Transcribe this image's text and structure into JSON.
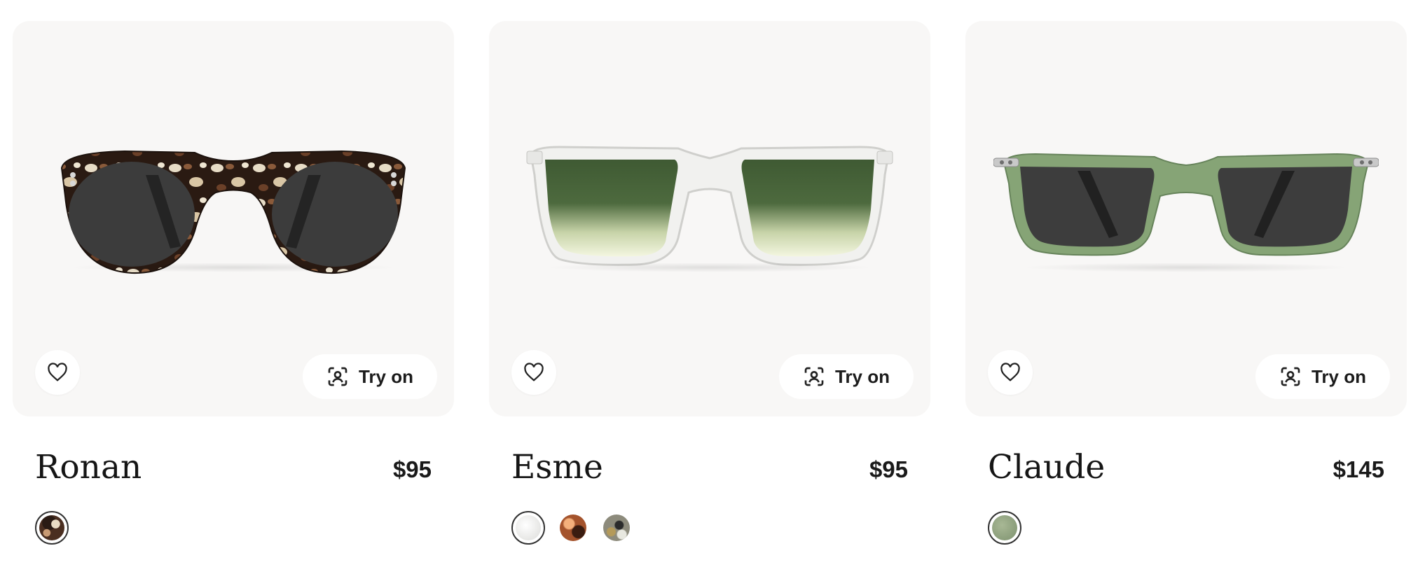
{
  "products": [
    {
      "name": "Ronan",
      "price": "$95",
      "try_on_label": "Try on",
      "frame_color": "#3a2418",
      "swatches": [
        {
          "color": "tortoise",
          "selected": true
        }
      ]
    },
    {
      "name": "Esme",
      "price": "$95",
      "try_on_label": "Try on",
      "frame_color": "#e4e4e2",
      "swatches": [
        {
          "color": "crystal",
          "selected": true
        },
        {
          "color": "amber-tortoise",
          "selected": false
        },
        {
          "color": "grey-tortoise",
          "selected": false
        }
      ]
    },
    {
      "name": "Claude",
      "price": "$145",
      "try_on_label": "Try on",
      "frame_color": "#7f9a72",
      "swatches": [
        {
          "color": "sage-green",
          "selected": true
        }
      ]
    }
  ],
  "icons": {
    "favorite": "heart-icon",
    "try_on": "face-scan-icon"
  }
}
